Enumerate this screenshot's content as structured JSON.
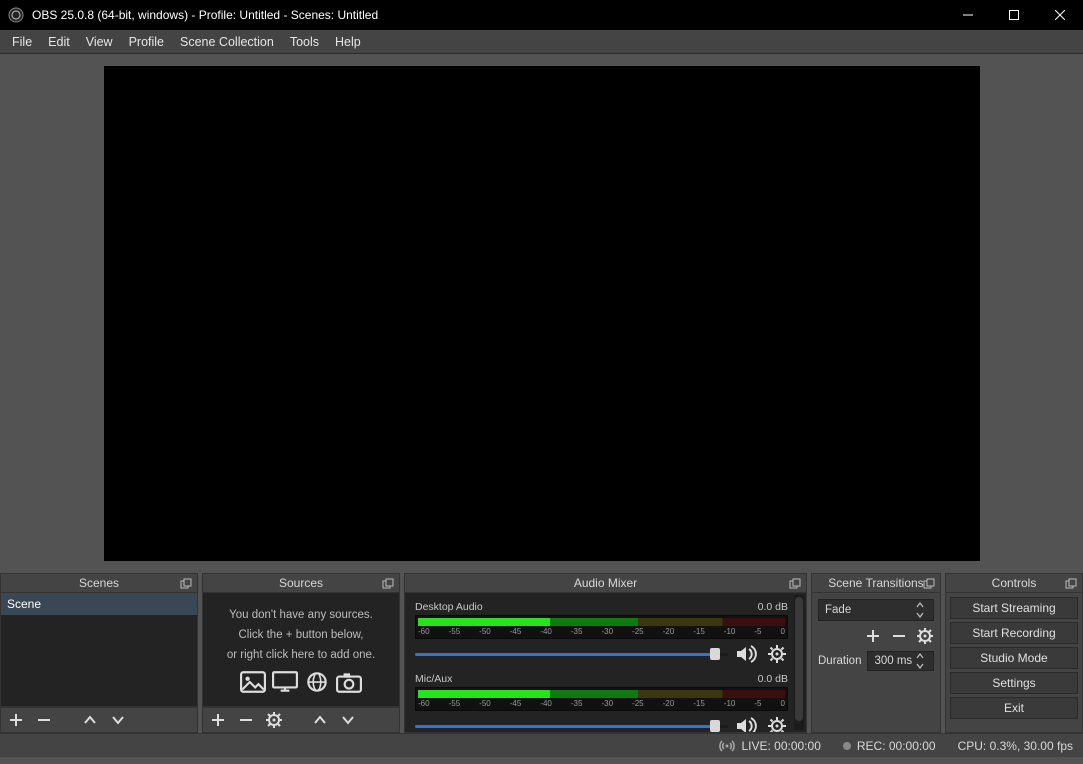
{
  "titlebar": {
    "title": "OBS 25.0.8 (64-bit, windows) - Profile: Untitled - Scenes: Untitled"
  },
  "menu": {
    "items": [
      "File",
      "Edit",
      "View",
      "Profile",
      "Scene Collection",
      "Tools",
      "Help"
    ]
  },
  "docks": {
    "scenes": {
      "title": "Scenes",
      "items": [
        "Scene"
      ]
    },
    "sources": {
      "title": "Sources",
      "empty_msg_l1": "You don't have any sources.",
      "empty_msg_l2": "Click the + button below,",
      "empty_msg_l3": "or right click here to add one."
    },
    "mixer": {
      "title": "Audio Mixer",
      "ticks": [
        "-60",
        "-55",
        "-50",
        "-45",
        "-40",
        "-35",
        "-30",
        "-25",
        "-20",
        "-15",
        "-10",
        "-5",
        "0"
      ],
      "channels": [
        {
          "name": "Desktop Audio",
          "level_db": "0.0 dB"
        },
        {
          "name": "Mic/Aux",
          "level_db": "0.0 dB"
        }
      ]
    },
    "transitions": {
      "title": "Scene Transitions",
      "selected": "Fade",
      "duration_label": "Duration",
      "duration_value": "300 ms"
    },
    "controls": {
      "title": "Controls",
      "buttons": [
        "Start Streaming",
        "Start Recording",
        "Studio Mode",
        "Settings",
        "Exit"
      ]
    }
  },
  "statusbar": {
    "live": "LIVE: 00:00:00",
    "rec": "REC: 00:00:00",
    "cpu": "CPU: 0.3%, 30.00 fps"
  }
}
